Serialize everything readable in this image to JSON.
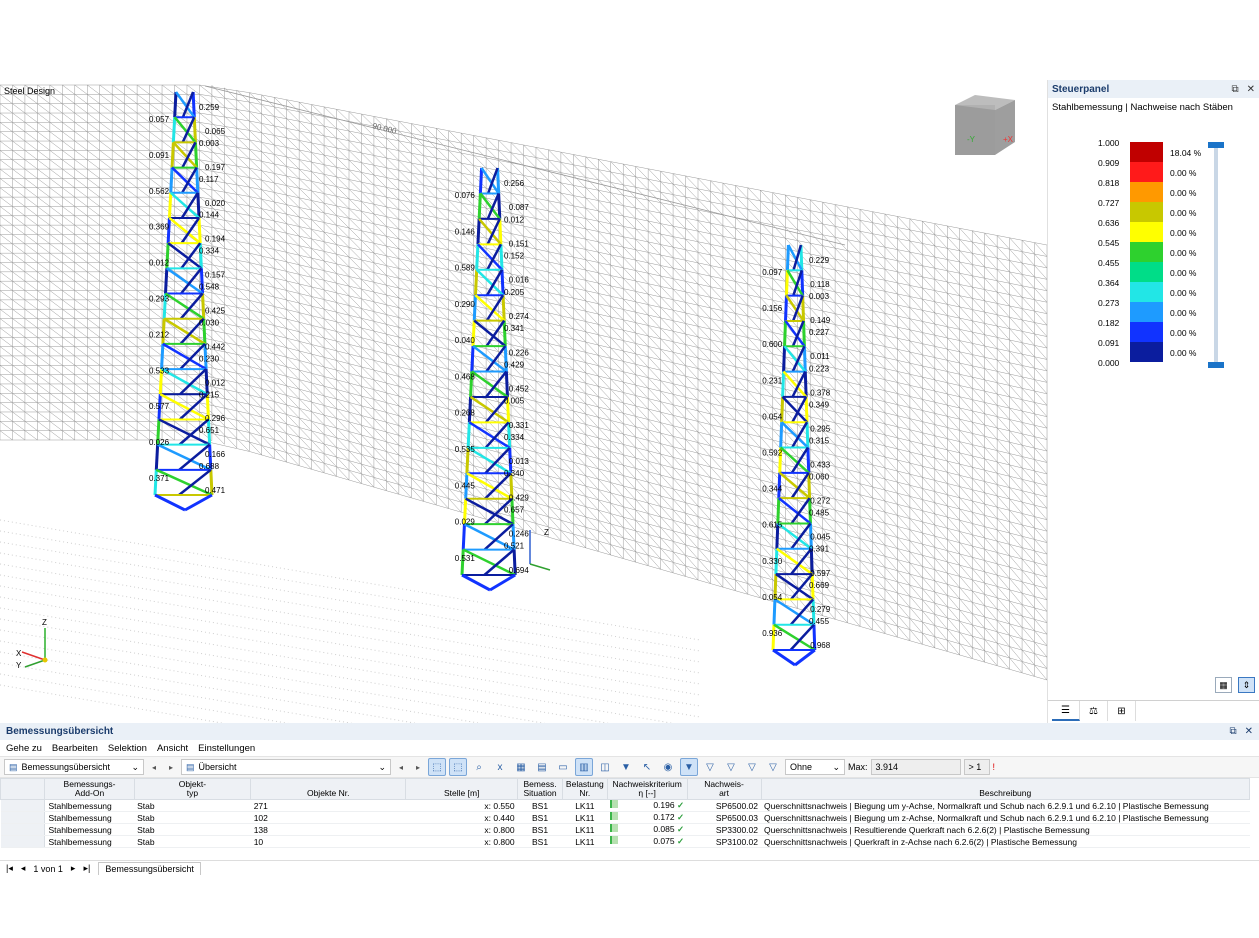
{
  "viewport": {
    "title": "Steel Design",
    "dimension_label": "90.000",
    "cube_labels": [
      "-Y",
      "+X"
    ],
    "axes": {
      "z": "Z",
      "x": "X",
      "y": "Y"
    }
  },
  "towers": [
    {
      "labels": [
        "0.259",
        "0.057",
        "0.065",
        "0.003",
        "0.091",
        "0.197",
        "0.117",
        "0.562",
        "0.020",
        "0.144",
        "0.369",
        "0.194",
        "0.334",
        "0.012",
        "0.157",
        "0.548",
        "0.293",
        "0.425",
        "0.030",
        "0.212",
        "0.442",
        "0.230",
        "0.533",
        "0.012",
        "0.215",
        "0.577",
        "0.296",
        "0.651",
        "0.026",
        "0.166",
        "0.688",
        "0.371",
        "0.471"
      ]
    },
    {
      "labels": [
        "0.256",
        "0.076",
        "0.087",
        "0.012",
        "0.146",
        "0.151",
        "0.152",
        "0.589",
        "0.016",
        "0.205",
        "0.290",
        "0.274",
        "0.341",
        "0.040",
        "0.226",
        "0.429",
        "0.468",
        "0.452",
        "0.005",
        "0.268",
        "0.331",
        "0.334",
        "0.535",
        "0.013",
        "0.340",
        "0.445",
        "0.429",
        "0.657",
        "0.029",
        "0.246",
        "0.521",
        "0.531",
        "0.694"
      ]
    },
    {
      "labels": [
        "0.229",
        "0.097",
        "0.118",
        "0.003",
        "0.156",
        "0.149",
        "0.227",
        "0.600",
        "0.011",
        "0.223",
        "0.231",
        "0.378",
        "0.349",
        "0.054",
        "0.295",
        "0.315",
        "0.592",
        "0.433",
        "0.060",
        "0.344",
        "0.272",
        "0.485",
        "0.615",
        "0.045",
        "0.391",
        "0.330",
        "0.597",
        "0.669",
        "0.054",
        "0.279",
        "0.455",
        "0.936",
        "0.968"
      ]
    }
  ],
  "panel": {
    "title": "Steuerpanel",
    "subtitle": "Stahlbemessung | Nachweise nach Stäben",
    "pin_icon": "pin-icon",
    "close_icon": "close-icon",
    "legend": [
      {
        "value": "1.000",
        "color": "#c00000",
        "pct": "18.04 %"
      },
      {
        "value": "0.909",
        "color": "#ff1a1a",
        "pct": "0.00 %"
      },
      {
        "value": "0.818",
        "color": "#ff9900",
        "pct": "0.00 %"
      },
      {
        "value": "0.727",
        "color": "#c8c800",
        "pct": "0.00 %"
      },
      {
        "value": "0.636",
        "color": "#ffff00",
        "pct": "0.00 %"
      },
      {
        "value": "0.545",
        "color": "#2ed12e",
        "pct": "0.00 %"
      },
      {
        "value": "0.455",
        "color": "#00dd88",
        "pct": "0.00 %"
      },
      {
        "value": "0.364",
        "color": "#22e6e6",
        "pct": "0.00 %"
      },
      {
        "value": "0.273",
        "color": "#1e9bff",
        "pct": "0.00 %"
      },
      {
        "value": "0.182",
        "color": "#1133ff",
        "pct": "0.00 %"
      },
      {
        "value": "0.091",
        "color": "#0b1d9e",
        "pct": "0.00 %"
      },
      {
        "value": "0.000",
        "color": "",
        "pct": ""
      }
    ]
  },
  "summary": {
    "title": "Bemessungsübersicht",
    "menu": [
      "Gehe zu",
      "Bearbeiten",
      "Selektion",
      "Ansicht",
      "Einstellungen"
    ],
    "dropdown1": "Bemessungsübersicht",
    "dropdown2": "Übersicht",
    "filter_value": "Ohne",
    "max_label": "Max:",
    "max_value": "3.914",
    "threshold": "> 1",
    "columns": [
      "Bemessungs-\nAdd-On",
      "Objekt-\ntyp",
      "Objekte Nr.",
      "Stelle [m]",
      "Bemess.\nSituation",
      "Belastung\nNr.",
      "Nachweiskriterium\nη [--]",
      "Nachweis-\nart",
      "Beschreibung"
    ],
    "rows": [
      [
        "Stahlbemessung",
        "Stab",
        "271",
        "x: 0.550",
        "BS1",
        "LK11",
        "0.196",
        "SP6500.02",
        "Querschnittsnachweis | Biegung um y-Achse, Normalkraft und Schub nach 6.2.9.1 und 6.2.10 | Plastische Bemessung"
      ],
      [
        "Stahlbemessung",
        "Stab",
        "102",
        "x: 0.440",
        "BS1",
        "LK11",
        "0.172",
        "SP6500.03",
        "Querschnittsnachweis | Biegung um z-Achse, Normalkraft und Schub nach 6.2.9.1 und 6.2.10 | Plastische Bemessung"
      ],
      [
        "Stahlbemessung",
        "Stab",
        "138",
        "x: 0.800",
        "BS1",
        "LK11",
        "0.085",
        "SP3300.02",
        "Querschnittsnachweis | Resultierende Querkraft nach 6.2.6(2) | Plastische Bemessung"
      ],
      [
        "Stahlbemessung",
        "Stab",
        "10",
        "x: 0.800",
        "BS1",
        "LK11",
        "0.075",
        "SP3100.02",
        "Querschnittsnachweis | Querkraft in z-Achse nach 6.2.6(2) | Plastische Bemessung"
      ]
    ],
    "pager": "1 von 1",
    "sheet_tab": "Bemessungsübersicht"
  }
}
